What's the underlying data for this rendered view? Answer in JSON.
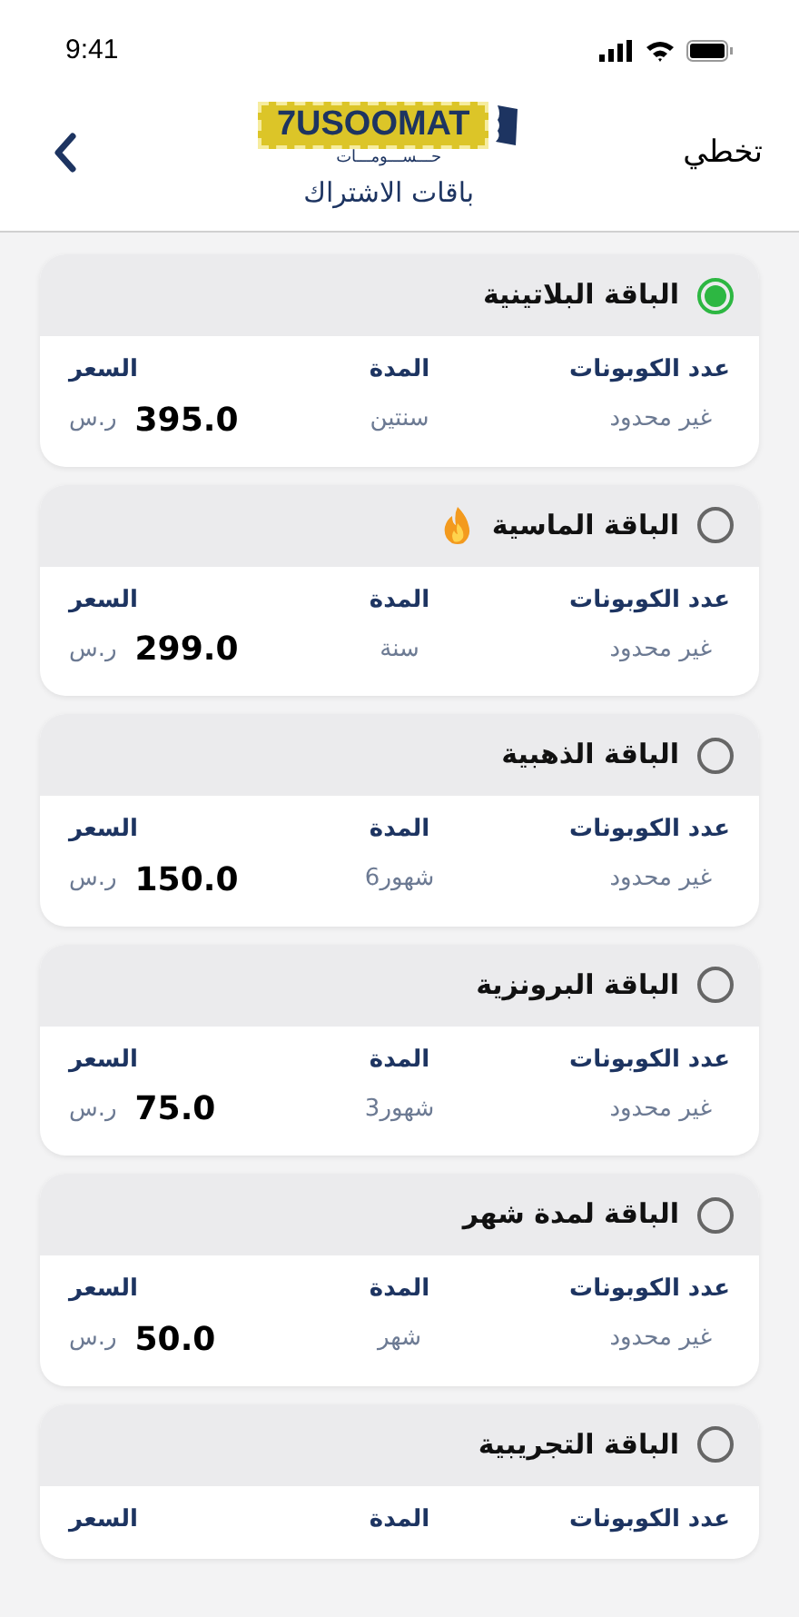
{
  "status_bar": {
    "time": "9:41"
  },
  "header": {
    "logo_text": "7USOOMAT",
    "logo_arabic": "حـــســـومـــات",
    "title": "باقات الاشتراك",
    "skip": "تخطي"
  },
  "plans": [
    {
      "name": "الباقة البلاتينية",
      "selected": true,
      "hot": false,
      "coupons_label": "عدد الكوبونات",
      "duration_label": "المدة",
      "price_label": "السعر",
      "coupons": "غير محدود",
      "duration": "سنتين",
      "price": "395.0",
      "currency": "ر.س"
    },
    {
      "name": "الباقة الماسية",
      "selected": false,
      "hot": true,
      "coupons_label": "عدد الكوبونات",
      "duration_label": "المدة",
      "price_label": "السعر",
      "coupons": "غير محدود",
      "duration": "سنة",
      "price": "299.0",
      "currency": "ر.س"
    },
    {
      "name": "الباقة الذهبية",
      "selected": false,
      "hot": false,
      "coupons_label": "عدد الكوبونات",
      "duration_label": "المدة",
      "price_label": "السعر",
      "coupons": "غير محدود",
      "duration": "شهور6",
      "price": "150.0",
      "currency": "ر.س"
    },
    {
      "name": "الباقة البرونزية",
      "selected": false,
      "hot": false,
      "coupons_label": "عدد الكوبونات",
      "duration_label": "المدة",
      "price_label": "السعر",
      "coupons": "غير محدود",
      "duration": "شهور3",
      "price": "75.0",
      "currency": "ر.س"
    },
    {
      "name": "الباقة لمدة شهر",
      "selected": false,
      "hot": false,
      "coupons_label": "عدد الكوبونات",
      "duration_label": "المدة",
      "price_label": "السعر",
      "coupons": "غير محدود",
      "duration": "شهر",
      "price": "50.0",
      "currency": "ر.س"
    },
    {
      "name": "الباقة التجريبية",
      "selected": false,
      "hot": false,
      "coupons_label": "عدد الكوبونات",
      "duration_label": "المدة",
      "price_label": "السعر"
    }
  ]
}
